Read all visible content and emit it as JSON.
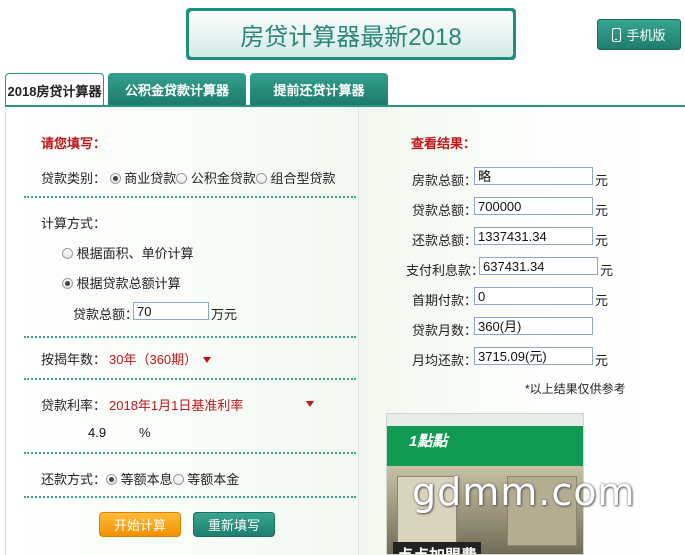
{
  "header": {
    "title": "房贷计算器最新2018",
    "mobile_label": "手机版"
  },
  "tabs": [
    {
      "label": "2018房贷计算器",
      "active": true
    },
    {
      "label": "公积金贷款计算器",
      "active": false
    },
    {
      "label": "提前还贷计算器",
      "active": false
    }
  ],
  "form": {
    "section_title": "请您填写：",
    "loan_type": {
      "label": "贷款类别：",
      "options": [
        {
          "label": "商业贷款",
          "selected": true
        },
        {
          "label": "公积金贷款",
          "selected": false
        },
        {
          "label": "组合型贷款",
          "selected": false
        }
      ]
    },
    "calc_method": {
      "label": "计算方式：",
      "options": [
        {
          "label": "根据面积、单价计算",
          "selected": false
        },
        {
          "label": "根据贷款总额计算",
          "selected": true
        }
      ]
    },
    "loan_total": {
      "label": "贷款总额：",
      "value": "70",
      "unit": "万元"
    },
    "term": {
      "label": "按揭年数：",
      "selected": "30年（360期）"
    },
    "rate": {
      "label": "贷款利率：",
      "selected": "2018年1月1日基准利率",
      "value": "4.9",
      "unit": "%"
    },
    "repay": {
      "label": "还款方式：",
      "options": [
        {
          "label": "等额本息",
          "selected": true
        },
        {
          "label": "等额本金",
          "selected": false
        }
      ]
    },
    "submit_label": "开始计算",
    "reset_label": "重新填写"
  },
  "results": {
    "section_title": "查看结果：",
    "rows": [
      {
        "label": "房款总额：",
        "value": "略",
        "unit": "元"
      },
      {
        "label": "贷款总额：",
        "value": "700000",
        "unit": "元"
      },
      {
        "label": "还款总额：",
        "value": "1337431.34",
        "unit": "元"
      },
      {
        "label": "支付利息款：",
        "value": "637431.34",
        "unit": "元"
      },
      {
        "label": "首期付款：",
        "value": "0",
        "unit": "元"
      },
      {
        "label": "贷款月数：",
        "value": "360(月)",
        "unit": ""
      },
      {
        "label": "月均还款：",
        "value": "3715.09(元)",
        "unit": "元"
      }
    ],
    "note": "*以上结果仅供参考"
  },
  "ad": {
    "logo": "1點點",
    "caption": "点点加盟费"
  },
  "watermark": "gdmm.com",
  "colors": {
    "accent": "#1d8f7f",
    "label_red": "#c0161a",
    "button_orange": "#f5a31a"
  }
}
